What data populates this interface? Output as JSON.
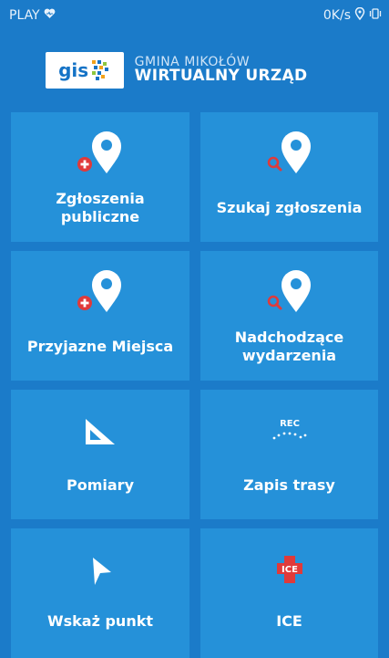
{
  "status_bar": {
    "carrier": "PLAY",
    "speed": "0K/s"
  },
  "header": {
    "logo_text_main": "gis",
    "title_line1": "GMINA MIKOŁÓW",
    "title_line2": "WIRTUALNY URZĄD"
  },
  "tiles": [
    {
      "label": "Zgłoszenia publiczne",
      "icon": "pin-add-icon"
    },
    {
      "label": "Szukaj zgłoszenia",
      "icon": "pin-search-icon"
    },
    {
      "label": "Przyjazne Miejsca",
      "icon": "pin-add-icon"
    },
    {
      "label": "Nadchodzące wydarzenia",
      "icon": "pin-search-icon"
    },
    {
      "label": "Pomiary",
      "icon": "ruler-triangle-icon"
    },
    {
      "label": "Zapis trasy",
      "icon": "rec-route-icon"
    },
    {
      "label": "Wskaż punkt",
      "icon": "pointer-arrow-icon"
    },
    {
      "label": "ICE",
      "icon": "ice-cross-icon"
    }
  ],
  "icons": {
    "rec_text": "REC",
    "ice_text": "ICE"
  },
  "colors": {
    "background": "#1b7bc9",
    "tile": "#2591d9",
    "badge_red": "#e03a3a"
  }
}
